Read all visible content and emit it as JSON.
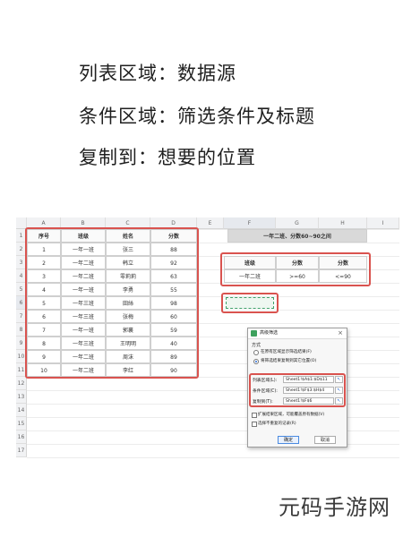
{
  "headlines": [
    "列表区域：数据源",
    "条件区域：筛选条件及标题",
    "复制到：想要的位置"
  ],
  "columns": [
    "A",
    "B",
    "C",
    "D",
    "E",
    "F",
    "G",
    "H",
    "I"
  ],
  "rows": [
    "1",
    "2",
    "3",
    "4",
    "5",
    "6",
    "7",
    "8",
    "9",
    "10",
    "11",
    "12",
    "13",
    "14",
    "15",
    "16",
    "17"
  ],
  "table": {
    "headers": [
      "序号",
      "班级",
      "姓名",
      "分数"
    ],
    "rows": [
      [
        "1",
        "一年一班",
        "张三",
        "88"
      ],
      [
        "2",
        "一年二班",
        "韩立",
        "92"
      ],
      [
        "3",
        "一年二班",
        "零莉莉",
        "63"
      ],
      [
        "4",
        "一年一班",
        "李勇",
        "55"
      ],
      [
        "5",
        "一年三班",
        "田絲",
        "98"
      ],
      [
        "6",
        "一年三班",
        "张梅",
        "60"
      ],
      [
        "7",
        "一年一班",
        "郭襄",
        "59"
      ],
      [
        "8",
        "一年三班",
        "王明明",
        "40"
      ],
      [
        "9",
        "一年二班",
        "周沫",
        "89"
      ],
      [
        "10",
        "一年二班",
        "李红",
        "90"
      ]
    ]
  },
  "criteria": {
    "title": "一年二班、分数60~90之间",
    "headers": [
      "班级",
      "分数",
      "分数"
    ],
    "values": [
      "一年二班",
      ">=60",
      "<=90"
    ]
  },
  "dialog": {
    "title": "高级筛选",
    "method_label": "方式",
    "option1": "在原有区域显示筛选结果(F)",
    "option2": "将筛选结果复制到其它位置(O)",
    "list_label": "列表区域(L):",
    "list_value": "Sheet1!$A$1:$D$11",
    "criteria_label": "条件区域(C):",
    "criteria_value": "Sheet1!$F$3:$H$4",
    "copy_label": "复制到(T):",
    "copy_value": "Sheet1!$F$6",
    "extend_label": "扩展结果区域，可能覆盖原有数据(V)",
    "unique_label": "选择不重复的记录(R)",
    "ok_label": "确定",
    "cancel_label": "取消"
  },
  "watermark": "元码手游网",
  "colors": {
    "highlight_border": "#d9534f",
    "selection_dash": "#3fa06a",
    "criteria_title_bg": "#d9d9d9"
  }
}
